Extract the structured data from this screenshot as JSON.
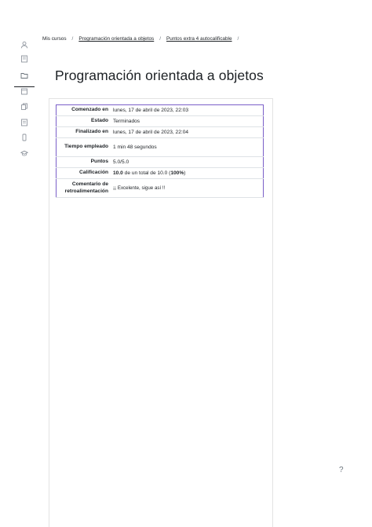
{
  "sidebar": {
    "items": [
      {
        "icon": "user-icon"
      },
      {
        "icon": "book-icon"
      },
      {
        "icon": "folder-icon",
        "active": true
      },
      {
        "icon": "calendar-icon"
      },
      {
        "icon": "files-icon"
      },
      {
        "icon": "list-icon"
      },
      {
        "icon": "phone-icon"
      },
      {
        "icon": "graduation-cap-icon"
      }
    ]
  },
  "breadcrumb": {
    "items": [
      "Mis cursos",
      "Programación orientada a objetos",
      "Puntos extra 4 autocalificable"
    ],
    "separator": "/"
  },
  "page": {
    "title": "Programación orientada a objetos"
  },
  "summary": {
    "started_label": "Comenzado en",
    "started_value": "lunes, 17 de abril de 2023, 22:03",
    "state_label": "Estado",
    "state_value": "Terminados",
    "finished_label": "Finalizado en",
    "finished_value": "lunes, 17 de abril de 2023, 22:04",
    "time_label": "Tiempo empleado",
    "time_value": "1 min 48 segundos",
    "points_label": "Puntos",
    "points_value": "5.0/5.0",
    "grade_label": "Calificación",
    "grade_bold": "10.0",
    "grade_mid": " de un total de 10.0 (",
    "grade_pct": "100%",
    "grade_end": ")",
    "feedback_label": "Comentario de retroalimentación",
    "feedback_value": "¡¡ Excelente, sigue así !!"
  },
  "help": {
    "label": "?"
  },
  "colors": {
    "accent": "#7a5fc8",
    "text": "#1d2125"
  }
}
